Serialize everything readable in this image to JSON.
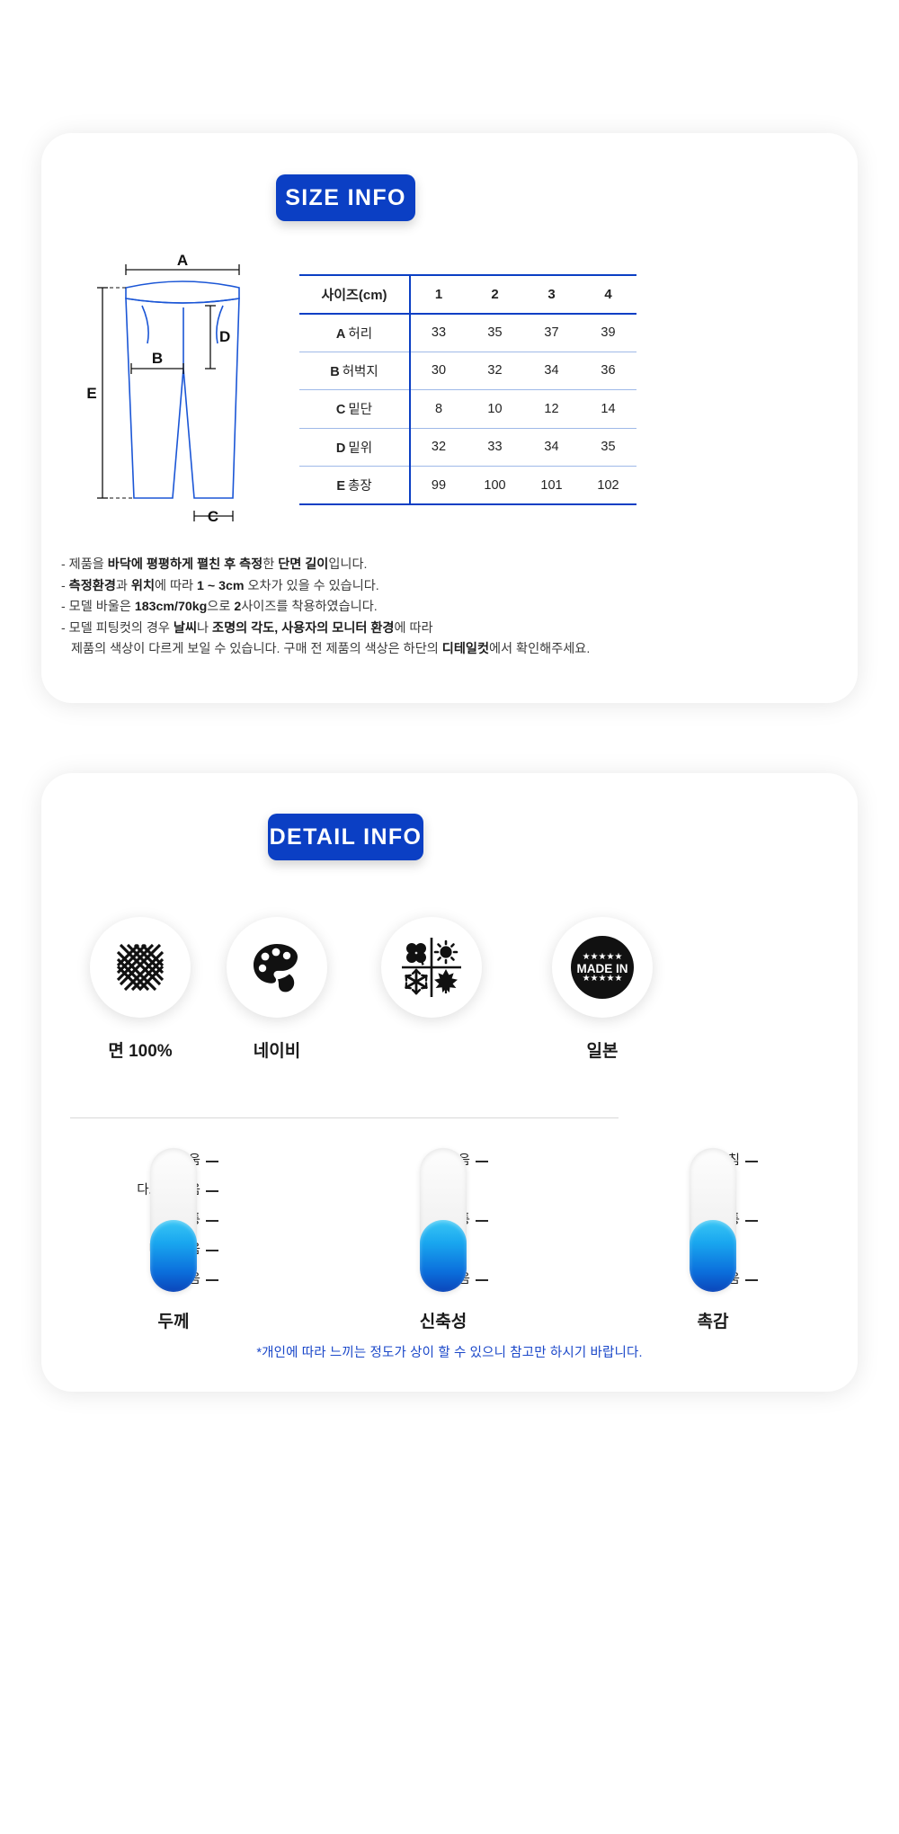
{
  "size_section": {
    "badge_label": "SIZE INFO",
    "diagram": {
      "name": "pants-measurement-diagram",
      "markers": [
        "A",
        "B",
        "C",
        "D",
        "E"
      ]
    },
    "table": {
      "header": [
        "사이즈(cm)",
        "1",
        "2",
        "3",
        "4"
      ],
      "rows": [
        {
          "letter": "A",
          "name": "허리",
          "values": [
            "33",
            "35",
            "37",
            "39"
          ]
        },
        {
          "letter": "B",
          "name": "허벅지",
          "values": [
            "30",
            "32",
            "34",
            "36"
          ]
        },
        {
          "letter": "C",
          "name": "밑단",
          "values": [
            "8",
            "10",
            "12",
            "14"
          ]
        },
        {
          "letter": "D",
          "name": "밑위",
          "values": [
            "32",
            "33",
            "34",
            "35"
          ]
        },
        {
          "letter": "E",
          "name": "총장",
          "values": [
            "99",
            "100",
            "101",
            "102"
          ]
        }
      ]
    },
    "notes": [
      "- 제품을 <b>바닥에 평평하게 펼친 후 측정</b>한 <b>단면 길이</b>입니다.",
      "- <b>측정환경</b>과 <b>위치</b>에 따라 <b>1 ~ 3cm</b> 오차가 있을 수 있습니다.",
      "- 모델 바울은 <b>183cm/70kg</b>으로 <b>2</b>사이즈를 착용하였습니다.",
      "- 모델 피팅컷의 경우 <b>날씨</b>나 <b>조명의 각도, 사용자의 모니터 환경</b>에 따라",
      "제품의 색상이 다르게 보일 수 있습니다. 구매 전 제품의 색상은 하단의 <b>디테일컷</b>에서 확인해주세요."
    ]
  },
  "detail_section": {
    "badge_label": "DETAIL INFO",
    "icons": [
      {
        "icon": "fabric-weave-icon",
        "label": "면 100%"
      },
      {
        "icon": "color-palette-icon",
        "label": "네이비"
      },
      {
        "icon": "four-seasons-icon",
        "label": ""
      },
      {
        "icon": "made-in-badge-icon",
        "label": "일본"
      }
    ],
    "gauges": [
      {
        "title": "두께",
        "name": "thickness-gauge",
        "ticks": [
          "두꺼움",
          "다소 두꺼움",
          "보통",
          "다소 얇음",
          "얇음"
        ],
        "fill_from_index": 2
      },
      {
        "title": "신축성",
        "name": "elasticity-gauge",
        "ticks": [
          "좋음",
          "보통",
          "없음"
        ],
        "fill_from_index": 1
      },
      {
        "title": "촉감",
        "name": "texture-gauge",
        "ticks": [
          "거침",
          "보통",
          "부드러움"
        ],
        "fill_from_index": 1
      }
    ],
    "bottom_note": "*개인에 따라 느끼는 정도가 상이 할 수 있으니 참고만 하시기 바랍니다.",
    "made_in_text": "MADE IN"
  },
  "colors": {
    "brand_blue": "#0b3fc4",
    "gauge_top": "#39c6f5",
    "gauge_bottom": "#0b46ba",
    "note_blue": "#1b48c9"
  }
}
